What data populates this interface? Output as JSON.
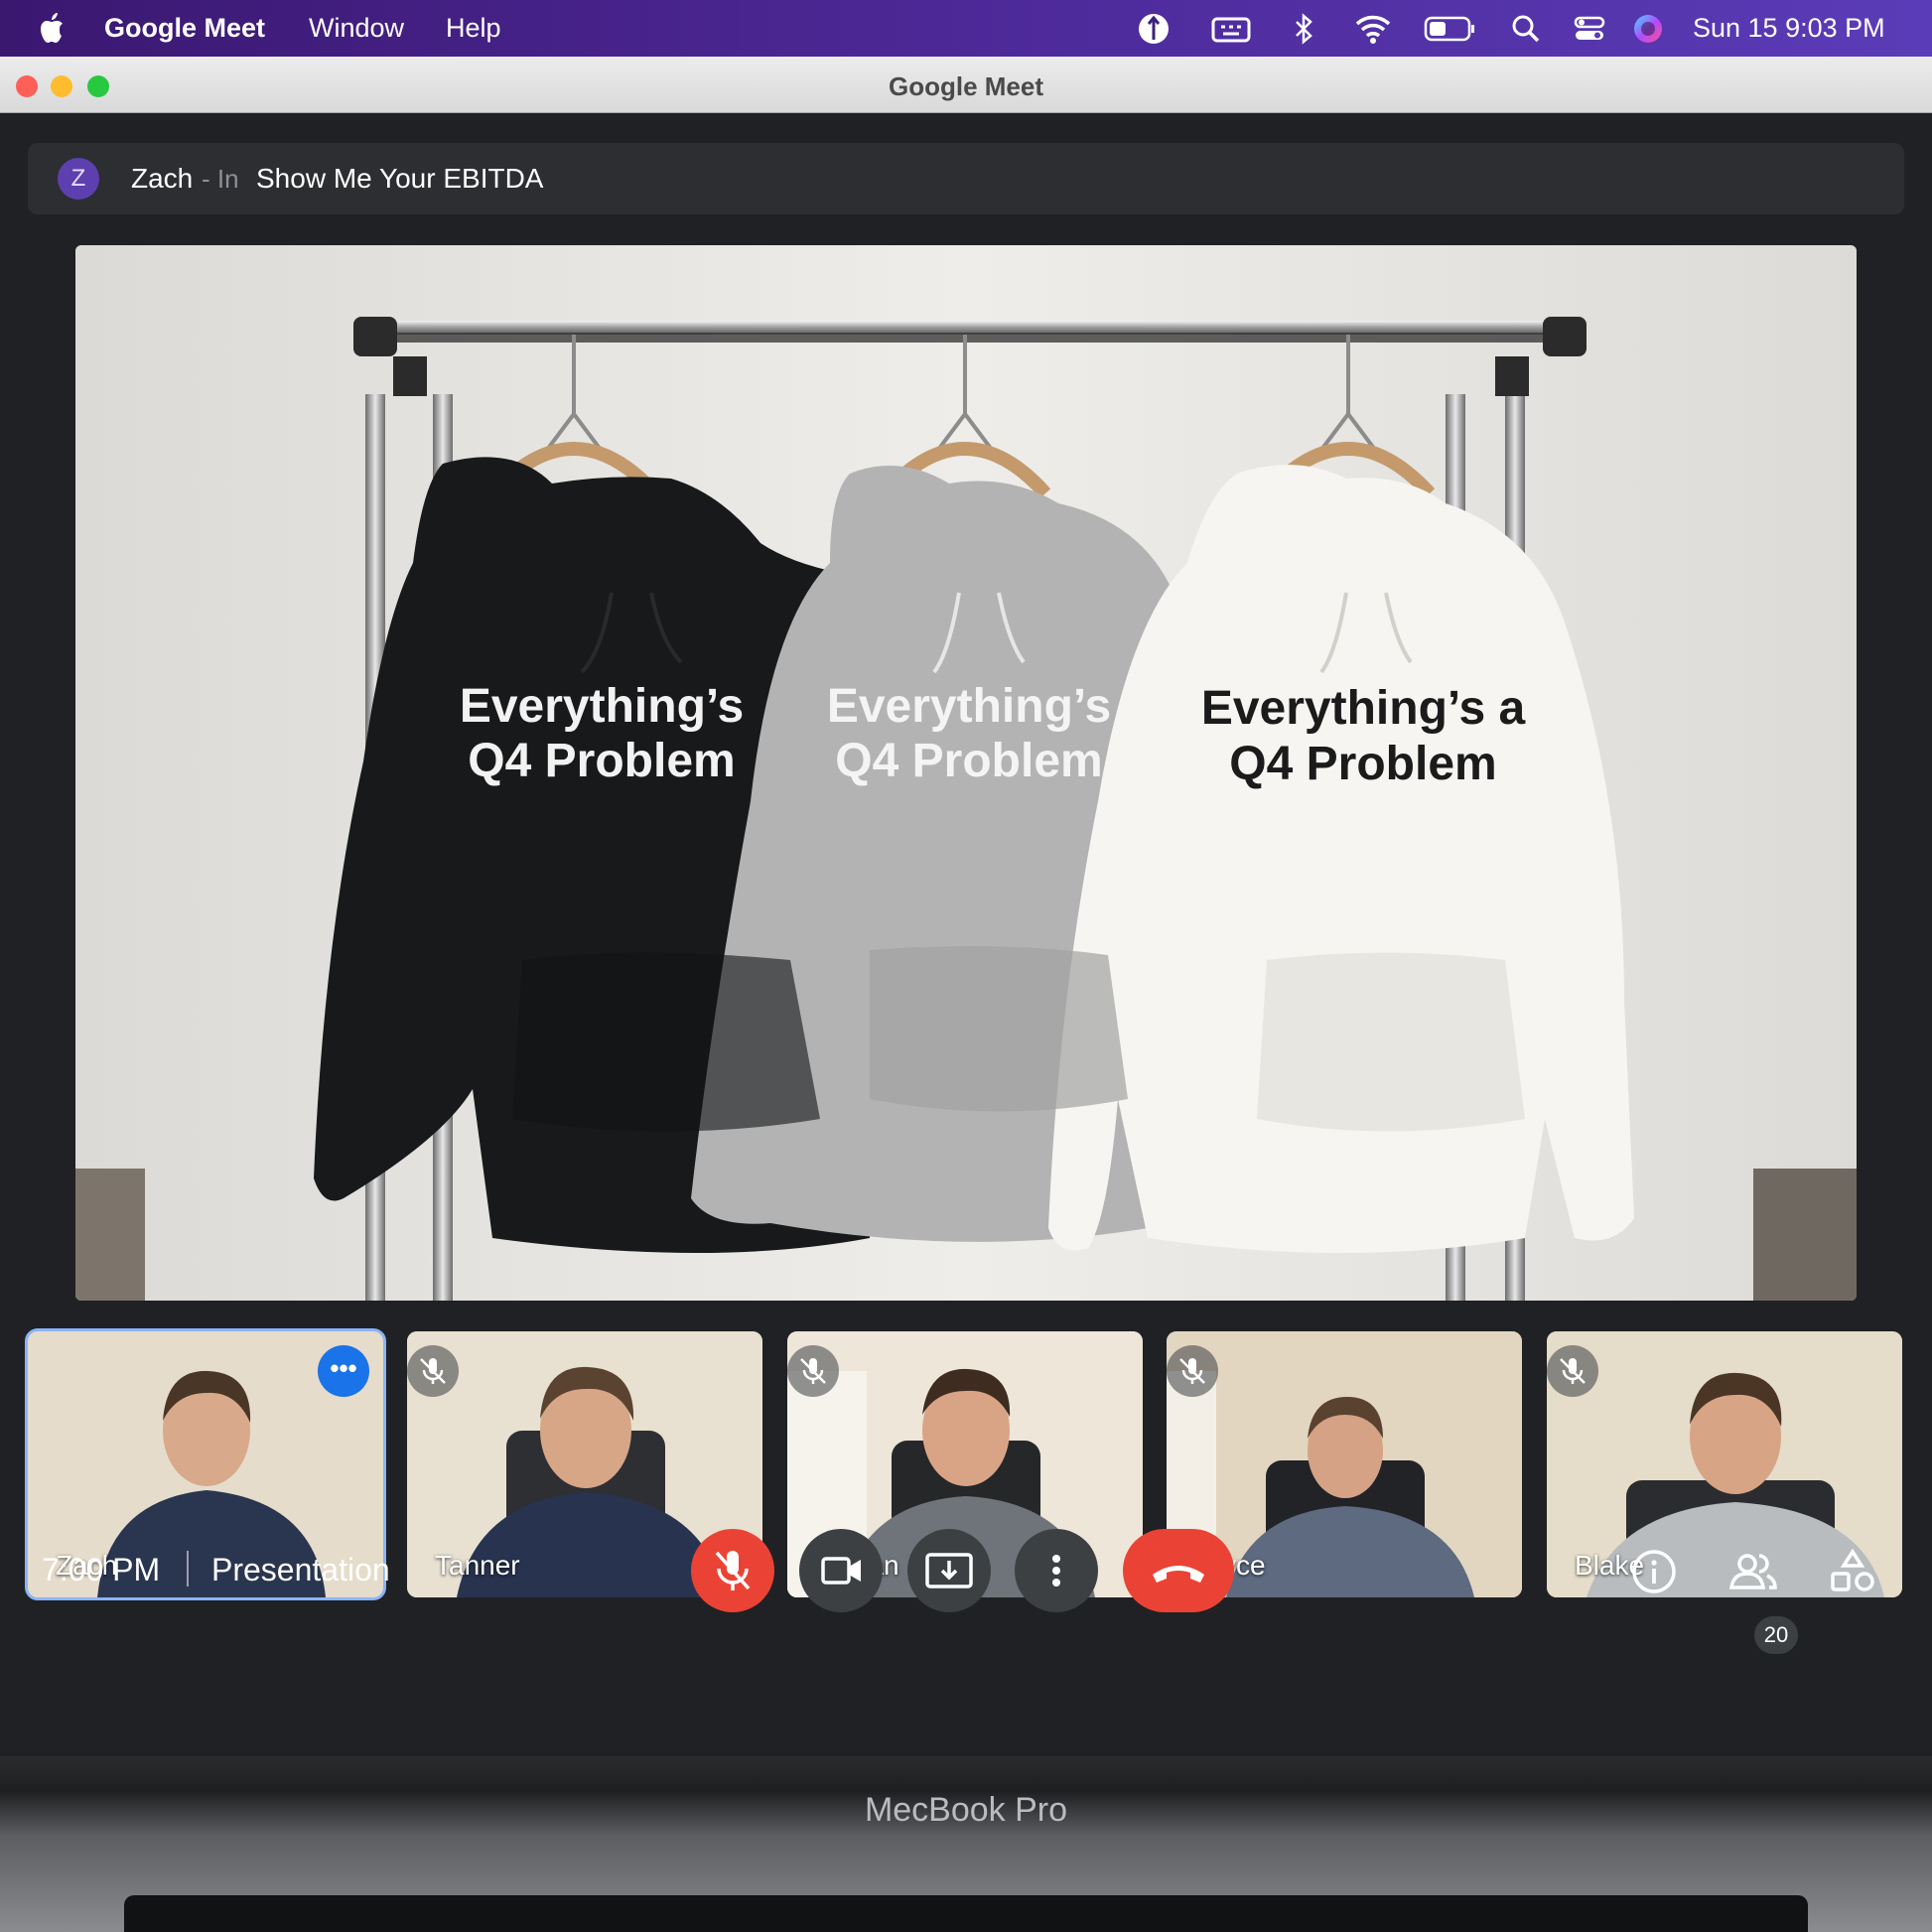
{
  "menubar": {
    "app_name": "Google Meet",
    "menus": [
      "Window",
      "Help"
    ],
    "clock": "Sun 15  9:03 PM",
    "status_icons": [
      "vpn-icon",
      "keyboard-icon",
      "bluetooth-icon",
      "wifi-icon",
      "battery-icon",
      "spotlight-search-icon",
      "control-center-icon",
      "siri-icon"
    ]
  },
  "window": {
    "title": "Google Meet"
  },
  "banner": {
    "avatar_initial": "Z",
    "presenter": "Zach",
    "separator": "- In",
    "meeting_title": "Show Me Your EBITDA"
  },
  "presentation": {
    "hoodies": [
      {
        "color": "#18191b",
        "text_color": "#f2f2f2",
        "line1": "Everything’s",
        "line2": "Q4 Problem"
      },
      {
        "color": "#b3b3b3",
        "text_color": "#f4f4f4",
        "line1": "Everything’s",
        "line2": "Q4 Problem"
      },
      {
        "color": "#f6f5f1",
        "text_color": "#1b1b1b",
        "line1": "Everything’s a",
        "line2": "Q4 Problem"
      }
    ]
  },
  "participants": [
    {
      "name": "Zach",
      "active": true,
      "muted": false,
      "shirt": "#2a3550"
    },
    {
      "name": "Tanner",
      "active": false,
      "muted": true,
      "shirt": "#283350"
    },
    {
      "name": "Tristan",
      "active": false,
      "muted": true,
      "shirt": "#6f747b"
    },
    {
      "name": "Bryce",
      "active": false,
      "muted": true,
      "shirt": "#5d6a80"
    },
    {
      "name": "Blake",
      "active": false,
      "muted": true,
      "shirt": "#b8bcbe"
    }
  ],
  "controls": {
    "time": "7:00 PM",
    "meeting_label": "Presentation",
    "participant_count": "20"
  },
  "laptop": {
    "brand": "MecBook Pro"
  },
  "colors": {
    "meet_bg": "#202124",
    "accent_blue": "#8ab4f8",
    "end_red": "#ea4335"
  }
}
